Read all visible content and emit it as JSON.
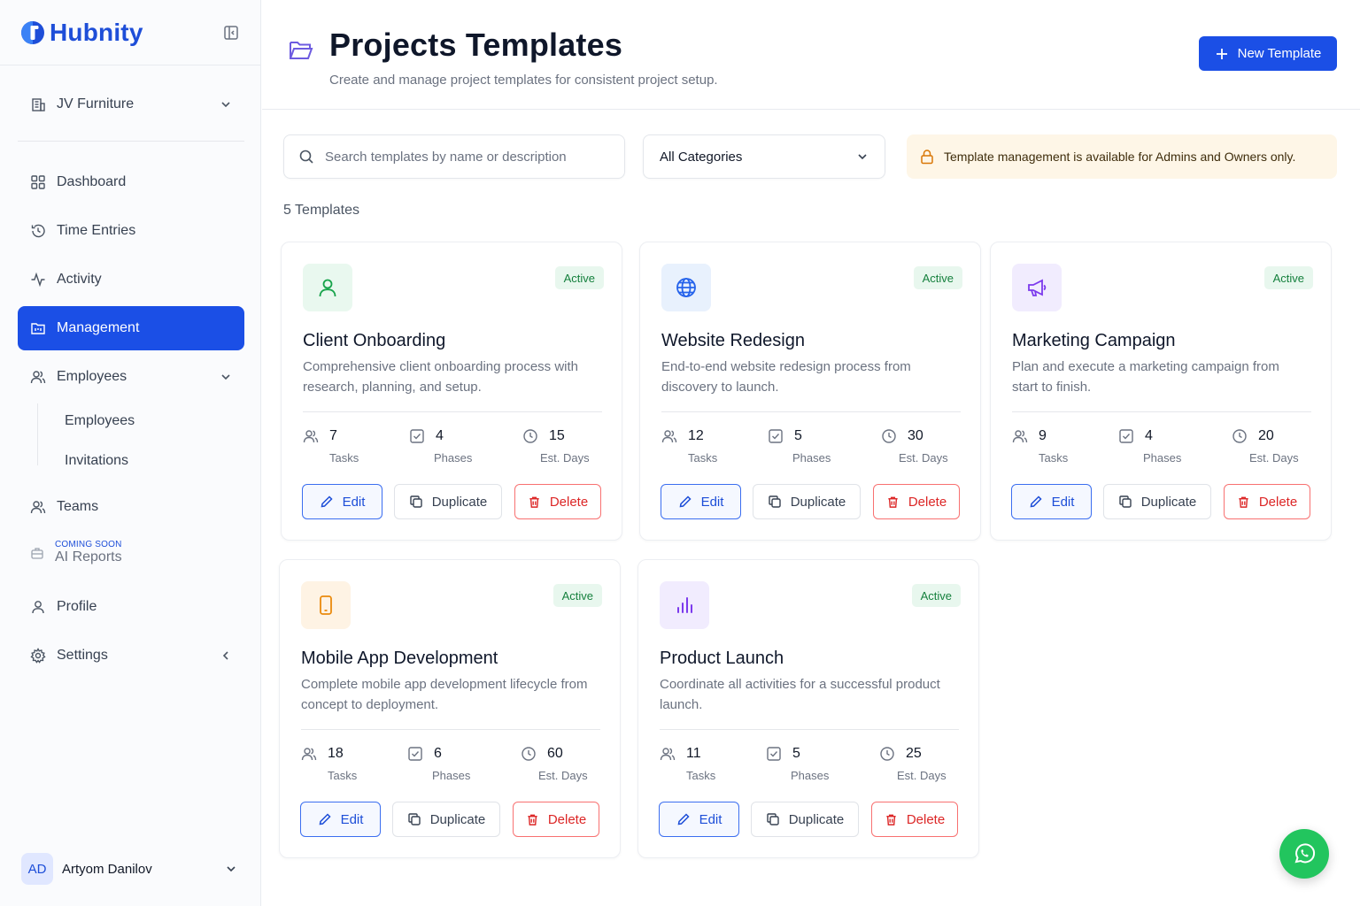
{
  "app": {
    "name": "Hubnity"
  },
  "sidebar": {
    "org": "JV Furniture",
    "nav": {
      "dashboard": "Dashboard",
      "time_entries": "Time Entries",
      "activity": "Activity",
      "management": "Management",
      "employees": "Employees",
      "employees_sub": "Employees",
      "invitations": "Invitations",
      "teams": "Teams",
      "coming_soon": "COMING SOON",
      "ai_reports": "AI Reports",
      "profile": "Profile",
      "settings": "Settings"
    },
    "user": {
      "initials": "AD",
      "name": "Artyom Danilov"
    }
  },
  "header": {
    "title": "Projects Templates",
    "subtitle": "Create and manage project templates for consistent project setup.",
    "new_button": "New Template"
  },
  "filters": {
    "search_placeholder": "Search templates by name or description",
    "category": "All Categories",
    "notice": "Template management is available for Admins and Owners only."
  },
  "count_label": "5 Templates",
  "labels": {
    "tasks": "Tasks",
    "phases": "Phases",
    "days": "Est. Days",
    "edit": "Edit",
    "duplicate": "Duplicate",
    "delete": "Delete"
  },
  "templates": [
    {
      "title": "Client Onboarding",
      "status": "Active",
      "description": "Comprehensive client onboarding process with research, planning, and setup.",
      "tasks": "7",
      "phases": "4",
      "days": "15",
      "icon": "user-icon",
      "icon_color": "#16a34a",
      "icon_bg": "#e9f8ef"
    },
    {
      "title": "Website Redesign",
      "status": "Active",
      "description": "End-to-end website redesign process from discovery to launch.",
      "tasks": "12",
      "phases": "5",
      "days": "30",
      "icon": "globe-icon",
      "icon_color": "#2563eb",
      "icon_bg": "#e8f1fd"
    },
    {
      "title": "Marketing Campaign",
      "status": "Active",
      "description": "Plan and execute a marketing campaign from start to finish.",
      "tasks": "9",
      "phases": "4",
      "days": "20",
      "icon": "megaphone-icon",
      "icon_color": "#7c3aed",
      "icon_bg": "#f1ecfe"
    },
    {
      "title": "Mobile App Development",
      "status": "Active",
      "description": "Complete mobile app development lifecycle from concept to deployment.",
      "tasks": "18",
      "phases": "6",
      "days": "60",
      "icon": "phone-icon",
      "icon_color": "#ea8a0c",
      "icon_bg": "#fef3e4"
    },
    {
      "title": "Product Launch",
      "status": "Active",
      "description": "Coordinate all activities for a successful product launch.",
      "tasks": "11",
      "phases": "5",
      "days": "25",
      "icon": "bar-chart-icon",
      "icon_color": "#7c3aed",
      "icon_bg": "#f1ecfe"
    }
  ],
  "colors": {
    "primary": "#1b4fe6",
    "active_badge_bg": "#e8f7ee",
    "danger": "#dc2626",
    "notice_bg": "#fef6e7",
    "whatsapp": "#22c55e"
  }
}
